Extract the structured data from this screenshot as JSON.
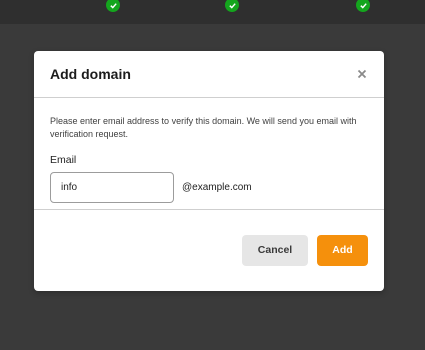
{
  "background": {
    "steps": [
      {
        "icon": "check-icon",
        "status_color": "#14a51d"
      },
      {
        "icon": "check-icon",
        "status_color": "#14a51d"
      },
      {
        "icon": "check-icon",
        "status_color": "#14a51d"
      }
    ]
  },
  "dialog": {
    "title": "Add domain",
    "close_icon": "close-icon",
    "description": "Please enter email address to verify this domain. We will send you email with verification request.",
    "email_label": "Email",
    "email_value": "info",
    "email_placeholder": "",
    "domain_suffix": "@example.com",
    "cancel_label": "Cancel",
    "add_label": "Add",
    "accent_color": "#f5900c"
  }
}
